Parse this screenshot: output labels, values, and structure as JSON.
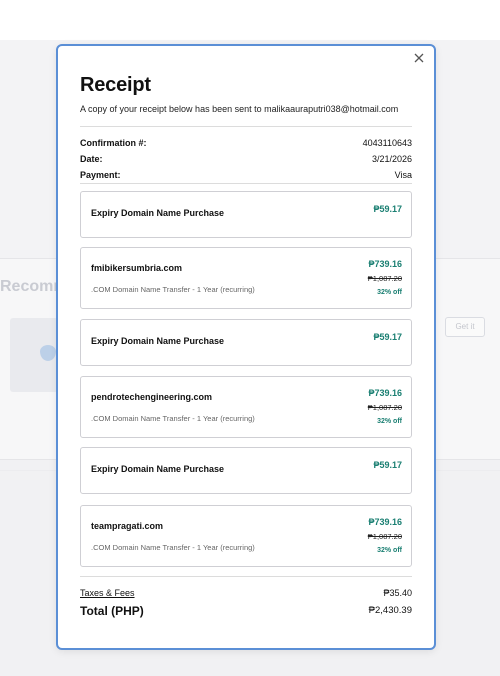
{
  "background": {
    "section_heading": "Recomm",
    "get_button_label": "Get it"
  },
  "receipt": {
    "title": "Receipt",
    "subtitle": "A copy of your receipt below has been sent to malikaauraputri038@hotmail.com",
    "close_icon": "close-icon",
    "details": [
      {
        "label": "Confirmation #:",
        "value": "4043110643"
      },
      {
        "label": "Date:",
        "value": "3/21/2026"
      },
      {
        "label": "Payment:",
        "value": "Visa"
      }
    ],
    "items": [
      {
        "name": "Expiry Domain Name Purchase",
        "price": "₱59.17"
      },
      {
        "name": "fmibikersumbria.com",
        "description": ".COM Domain Name Transfer - 1 Year (recurring)",
        "price": "₱739.16",
        "original_price": "₱1,087.20",
        "discount": "32% off"
      },
      {
        "name": "Expiry Domain Name Purchase",
        "price": "₱59.17"
      },
      {
        "name": "pendrotechengineering.com",
        "description": ".COM Domain Name Transfer - 1 Year (recurring)",
        "price": "₱739.16",
        "original_price": "₱1,087.20",
        "discount": "32% off"
      },
      {
        "name": "Expiry Domain Name Purchase",
        "price": "₱59.17"
      },
      {
        "name": "teampragati.com",
        "description": ".COM Domain Name Transfer - 1 Year (recurring)",
        "price": "₱739.16",
        "original_price": "₱1,087.20",
        "discount": "32% off"
      }
    ],
    "taxes_label": "Taxes & Fees",
    "taxes_value": "₱35.40",
    "total_label": "Total (PHP)",
    "total_value": "₱2,430.39",
    "colors": {
      "accent_border": "#5b8fd6",
      "price_green": "#1a7f72"
    }
  }
}
